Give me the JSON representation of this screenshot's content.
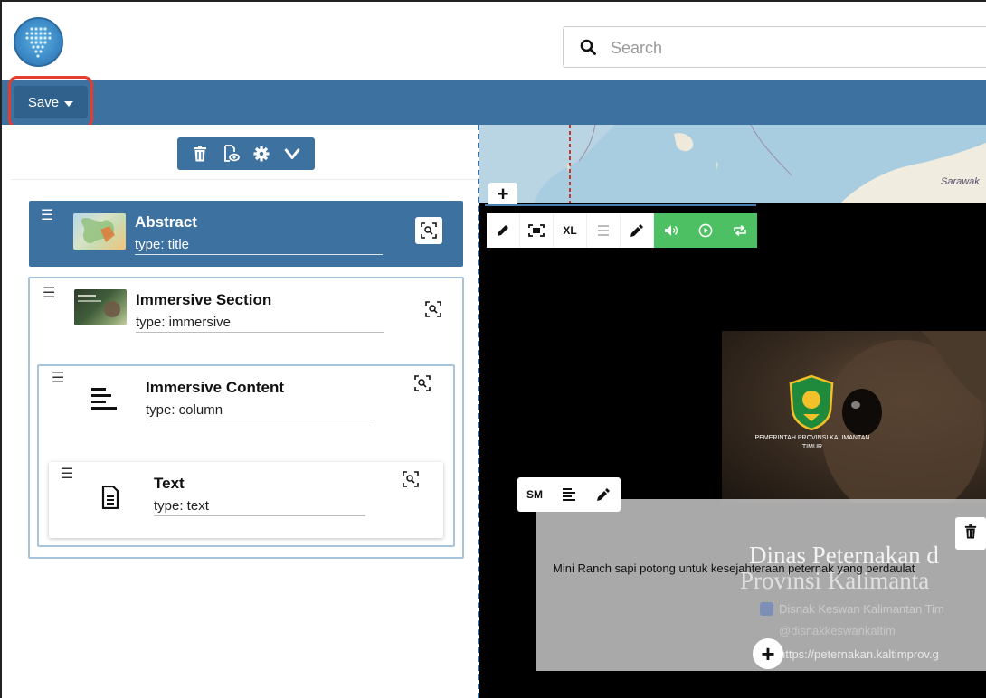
{
  "header": {
    "search": {
      "placeholder": "Search",
      "value": ""
    }
  },
  "toolbar": {
    "save_label": "Save"
  },
  "panel": {
    "actions": [
      "trash-icon",
      "preview-icon",
      "gear-icon",
      "chevron-down-icon"
    ],
    "items": [
      {
        "title": "Abstract",
        "type": "type: title",
        "selected": true
      },
      {
        "title": "Immersive Section",
        "type": "type: immersive"
      },
      {
        "title": "Immersive Content",
        "type": "type: column"
      },
      {
        "title": "Text",
        "type": "type: text"
      }
    ]
  },
  "preview": {
    "map_label": "Sarawak",
    "media_toolbar": {
      "size_label": "XL"
    },
    "emblem_text": "PEMERINTAH PROVINSI KALIMANTAN TIMUR",
    "text_toolbar": {
      "size_label": "SM"
    },
    "background_title_line1": "Dinas Peternakan d",
    "background_title_line2": "Provinsi Kalimanta",
    "caption": "Mini Ranch sapi potong untuk kesejahteraan peternak yang berdaulat",
    "social": [
      "Disnak Keswan Kalimantan Tim",
      "@disnakkeswankaltim",
      "https://peternakan.kaltimprov.g"
    ]
  },
  "colors": {
    "brand_blue": "#3c71a0",
    "save_button": "#2f618c",
    "highlight": "#e33d2f",
    "media_green": "#4cc063"
  }
}
